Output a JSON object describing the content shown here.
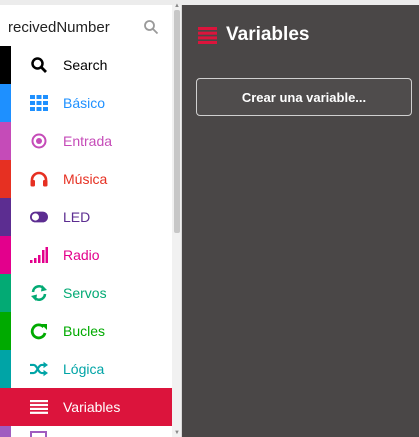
{
  "search": {
    "value": "recivedNumber"
  },
  "categories": [
    {
      "label": "Search",
      "color": "#000000",
      "text_color": "#000000",
      "icon": "search-icon"
    },
    {
      "label": "Básico",
      "color": "#1e90ff",
      "text_color": "#1e90ff",
      "icon": "grid-icon"
    },
    {
      "label": "Entrada",
      "color": "#c54bb8",
      "text_color": "#c54bb8",
      "icon": "radio-dot-icon"
    },
    {
      "label": "Música",
      "color": "#e63022",
      "text_color": "#e63022",
      "icon": "headphones-icon"
    },
    {
      "label": "LED",
      "color": "#5c2d91",
      "text_color": "#5c2d91",
      "icon": "toggle-icon"
    },
    {
      "label": "Radio",
      "color": "#e3008c",
      "text_color": "#e3008c",
      "icon": "signal-bars-icon"
    },
    {
      "label": "Servos",
      "color": "#03aa74",
      "text_color": "#03aa74",
      "icon": "sync-icon"
    },
    {
      "label": "Bucles",
      "color": "#00aa00",
      "text_color": "#00aa00",
      "icon": "loop-icon"
    },
    {
      "label": "Lógica",
      "color": "#00a4a6",
      "text_color": "#00a4a6",
      "icon": "shuffle-icon"
    },
    {
      "label": "Variables",
      "color": "#dc143c",
      "text_color": "#ffffff",
      "icon": "list-icon",
      "selected": true
    }
  ],
  "flyout": {
    "title": "Variables",
    "button_label": "Crear una variable...",
    "background": "#4a4747",
    "accent": "#dc143c"
  }
}
